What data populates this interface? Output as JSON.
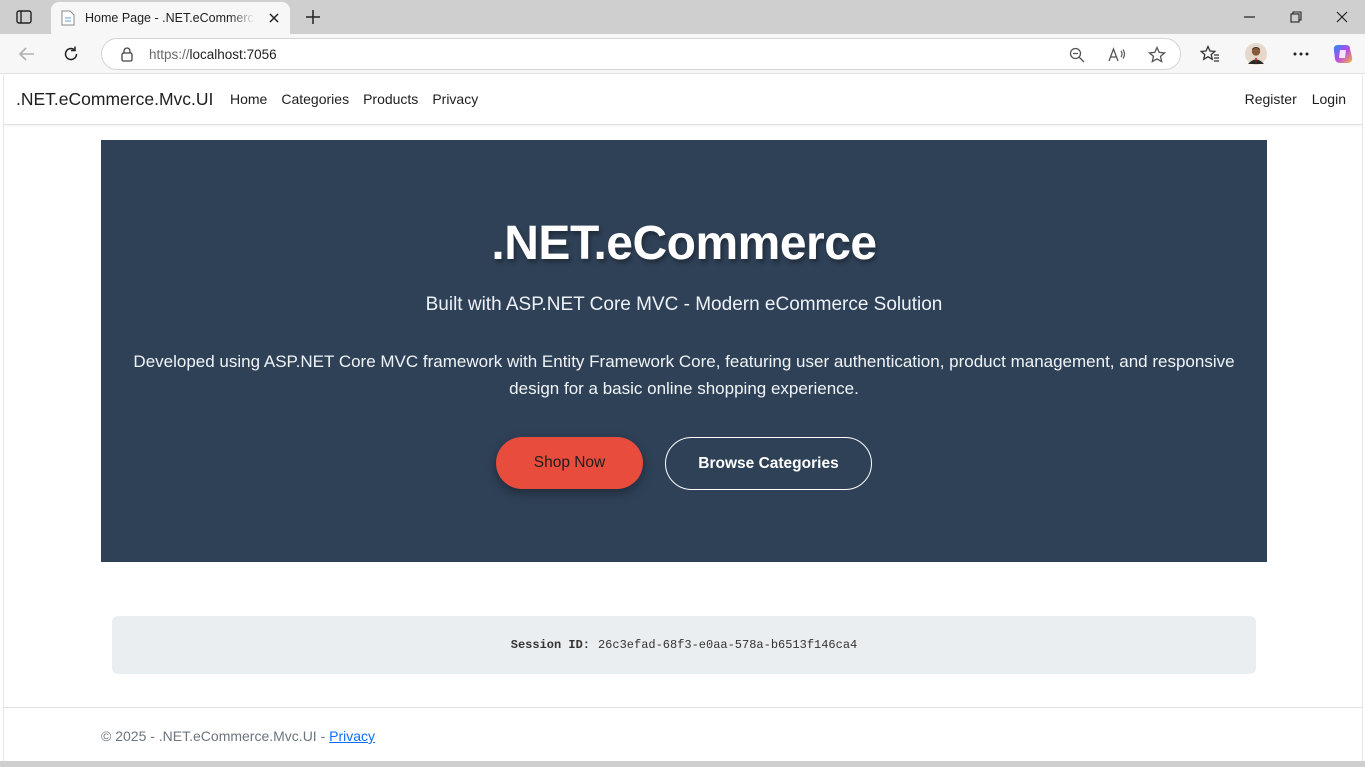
{
  "browser": {
    "tab_title": "Home Page - .NET.eCommerce.Mvc.UI",
    "url_scheme": "https://",
    "url_host": "localhost:7056"
  },
  "nav": {
    "brand": ".NET.eCommerce.Mvc.UI",
    "links": [
      "Home",
      "Categories",
      "Products",
      "Privacy"
    ],
    "register": "Register",
    "login": "Login"
  },
  "hero": {
    "title": ".NET.eCommerce",
    "subtitle": "Built with ASP.NET Core MVC - Modern eCommerce Solution",
    "description": "Developed using ASP.NET Core MVC framework with Entity Framework Core, featuring user authentication, product management, and responsive design for a basic online shopping experience.",
    "shop_button": "Shop Now",
    "browse_button": "Browse Categories"
  },
  "session": {
    "label": "Session ID:",
    "value": "26c3efad-68f3-e0aa-578a-b6513f146ca4"
  },
  "footer": {
    "text": "© 2025 - .NET.eCommerce.Mvc.UI - ",
    "privacy_link": "Privacy"
  },
  "colors": {
    "hero_bg": "#2f4157",
    "accent": "#e74c3c",
    "link": "#0d6efd"
  }
}
